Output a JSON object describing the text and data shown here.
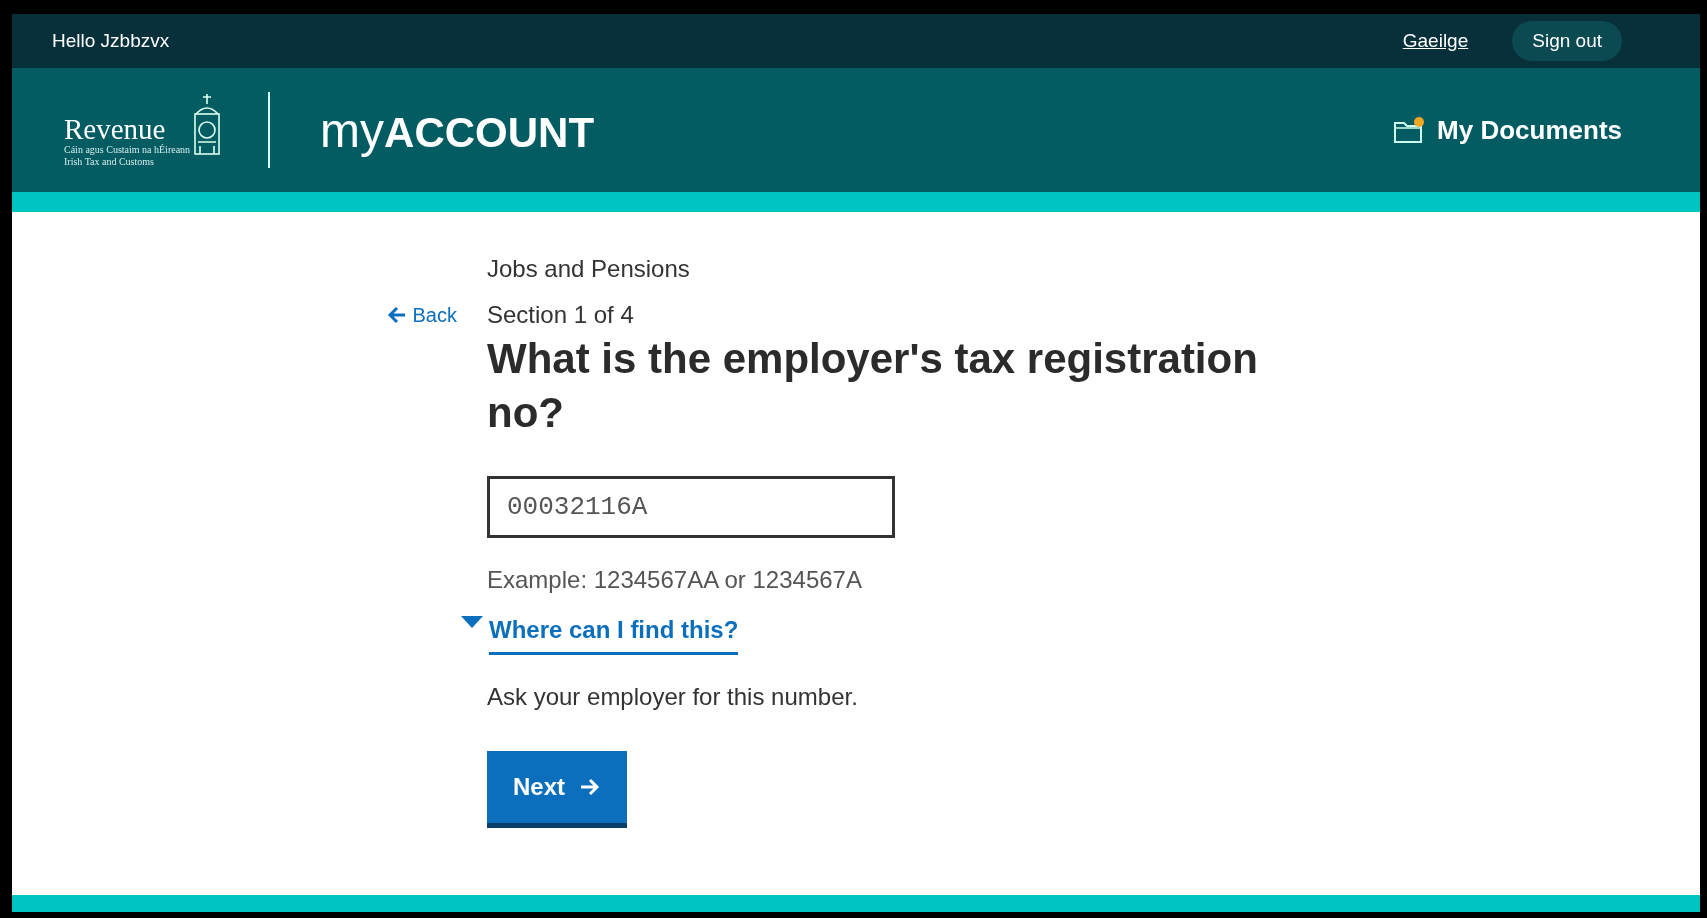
{
  "top_bar": {
    "greeting": "Hello Jzbbzvx",
    "language_link": "Gaeilge",
    "sign_out": "Sign out"
  },
  "header": {
    "logo": {
      "name": "Revenue",
      "subtitle_irish": "Cáin agus Custaim na hÉireann",
      "subtitle_english": "Irish Tax and Customs"
    },
    "app_name": {
      "prefix": "my",
      "main": "ACCOUNT"
    },
    "documents_link": {
      "label": "My Documents",
      "has_new": true
    }
  },
  "form": {
    "category": "Jobs and Pensions",
    "back_link": "Back",
    "section": "Section 1 of 4",
    "question": "What is the employer's tax registration no?",
    "input_value": "00032116A",
    "hint": "Example: 1234567AA or 1234567A",
    "details": {
      "summary": "Where can I find this?",
      "expanded": true,
      "text": "Ask your employer for this number."
    },
    "next_button": "Next"
  }
}
